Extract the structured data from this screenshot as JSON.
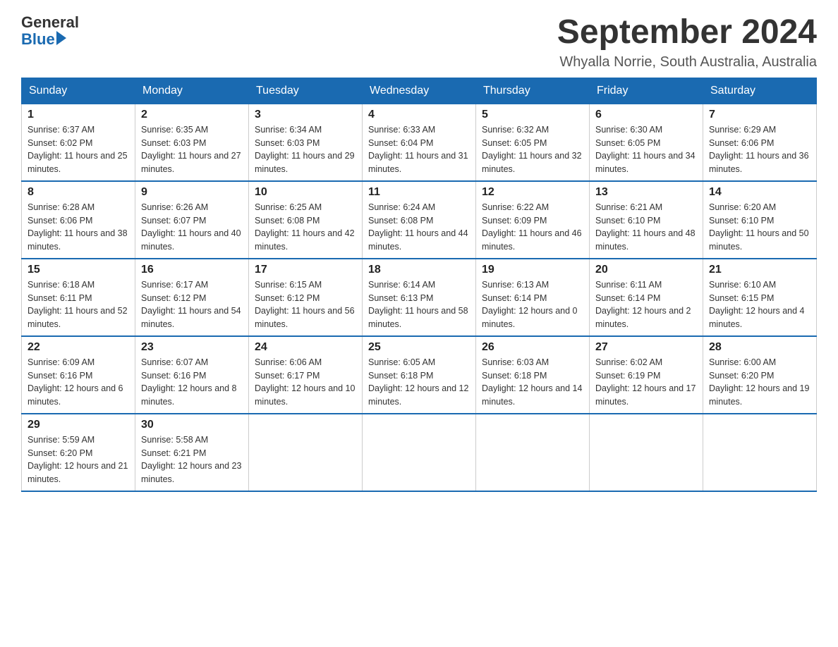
{
  "header": {
    "logo_general": "General",
    "logo_blue": "Blue",
    "month_title": "September 2024",
    "location": "Whyalla Norrie, South Australia, Australia"
  },
  "days_of_week": [
    "Sunday",
    "Monday",
    "Tuesday",
    "Wednesday",
    "Thursday",
    "Friday",
    "Saturday"
  ],
  "weeks": [
    [
      {
        "day": "1",
        "sunrise": "6:37 AM",
        "sunset": "6:02 PM",
        "daylight": "11 hours and 25 minutes."
      },
      {
        "day": "2",
        "sunrise": "6:35 AM",
        "sunset": "6:03 PM",
        "daylight": "11 hours and 27 minutes."
      },
      {
        "day": "3",
        "sunrise": "6:34 AM",
        "sunset": "6:03 PM",
        "daylight": "11 hours and 29 minutes."
      },
      {
        "day": "4",
        "sunrise": "6:33 AM",
        "sunset": "6:04 PM",
        "daylight": "11 hours and 31 minutes."
      },
      {
        "day": "5",
        "sunrise": "6:32 AM",
        "sunset": "6:05 PM",
        "daylight": "11 hours and 32 minutes."
      },
      {
        "day": "6",
        "sunrise": "6:30 AM",
        "sunset": "6:05 PM",
        "daylight": "11 hours and 34 minutes."
      },
      {
        "day": "7",
        "sunrise": "6:29 AM",
        "sunset": "6:06 PM",
        "daylight": "11 hours and 36 minutes."
      }
    ],
    [
      {
        "day": "8",
        "sunrise": "6:28 AM",
        "sunset": "6:06 PM",
        "daylight": "11 hours and 38 minutes."
      },
      {
        "day": "9",
        "sunrise": "6:26 AM",
        "sunset": "6:07 PM",
        "daylight": "11 hours and 40 minutes."
      },
      {
        "day": "10",
        "sunrise": "6:25 AM",
        "sunset": "6:08 PM",
        "daylight": "11 hours and 42 minutes."
      },
      {
        "day": "11",
        "sunrise": "6:24 AM",
        "sunset": "6:08 PM",
        "daylight": "11 hours and 44 minutes."
      },
      {
        "day": "12",
        "sunrise": "6:22 AM",
        "sunset": "6:09 PM",
        "daylight": "11 hours and 46 minutes."
      },
      {
        "day": "13",
        "sunrise": "6:21 AM",
        "sunset": "6:10 PM",
        "daylight": "11 hours and 48 minutes."
      },
      {
        "day": "14",
        "sunrise": "6:20 AM",
        "sunset": "6:10 PM",
        "daylight": "11 hours and 50 minutes."
      }
    ],
    [
      {
        "day": "15",
        "sunrise": "6:18 AM",
        "sunset": "6:11 PM",
        "daylight": "11 hours and 52 minutes."
      },
      {
        "day": "16",
        "sunrise": "6:17 AM",
        "sunset": "6:12 PM",
        "daylight": "11 hours and 54 minutes."
      },
      {
        "day": "17",
        "sunrise": "6:15 AM",
        "sunset": "6:12 PM",
        "daylight": "11 hours and 56 minutes."
      },
      {
        "day": "18",
        "sunrise": "6:14 AM",
        "sunset": "6:13 PM",
        "daylight": "11 hours and 58 minutes."
      },
      {
        "day": "19",
        "sunrise": "6:13 AM",
        "sunset": "6:14 PM",
        "daylight": "12 hours and 0 minutes."
      },
      {
        "day": "20",
        "sunrise": "6:11 AM",
        "sunset": "6:14 PM",
        "daylight": "12 hours and 2 minutes."
      },
      {
        "day": "21",
        "sunrise": "6:10 AM",
        "sunset": "6:15 PM",
        "daylight": "12 hours and 4 minutes."
      }
    ],
    [
      {
        "day": "22",
        "sunrise": "6:09 AM",
        "sunset": "6:16 PM",
        "daylight": "12 hours and 6 minutes."
      },
      {
        "day": "23",
        "sunrise": "6:07 AM",
        "sunset": "6:16 PM",
        "daylight": "12 hours and 8 minutes."
      },
      {
        "day": "24",
        "sunrise": "6:06 AM",
        "sunset": "6:17 PM",
        "daylight": "12 hours and 10 minutes."
      },
      {
        "day": "25",
        "sunrise": "6:05 AM",
        "sunset": "6:18 PM",
        "daylight": "12 hours and 12 minutes."
      },
      {
        "day": "26",
        "sunrise": "6:03 AM",
        "sunset": "6:18 PM",
        "daylight": "12 hours and 14 minutes."
      },
      {
        "day": "27",
        "sunrise": "6:02 AM",
        "sunset": "6:19 PM",
        "daylight": "12 hours and 17 minutes."
      },
      {
        "day": "28",
        "sunrise": "6:00 AM",
        "sunset": "6:20 PM",
        "daylight": "12 hours and 19 minutes."
      }
    ],
    [
      {
        "day": "29",
        "sunrise": "5:59 AM",
        "sunset": "6:20 PM",
        "daylight": "12 hours and 21 minutes."
      },
      {
        "day": "30",
        "sunrise": "5:58 AM",
        "sunset": "6:21 PM",
        "daylight": "12 hours and 23 minutes."
      },
      null,
      null,
      null,
      null,
      null
    ]
  ],
  "labels": {
    "sunrise_prefix": "Sunrise: ",
    "sunset_prefix": "Sunset: ",
    "daylight_prefix": "Daylight: "
  }
}
